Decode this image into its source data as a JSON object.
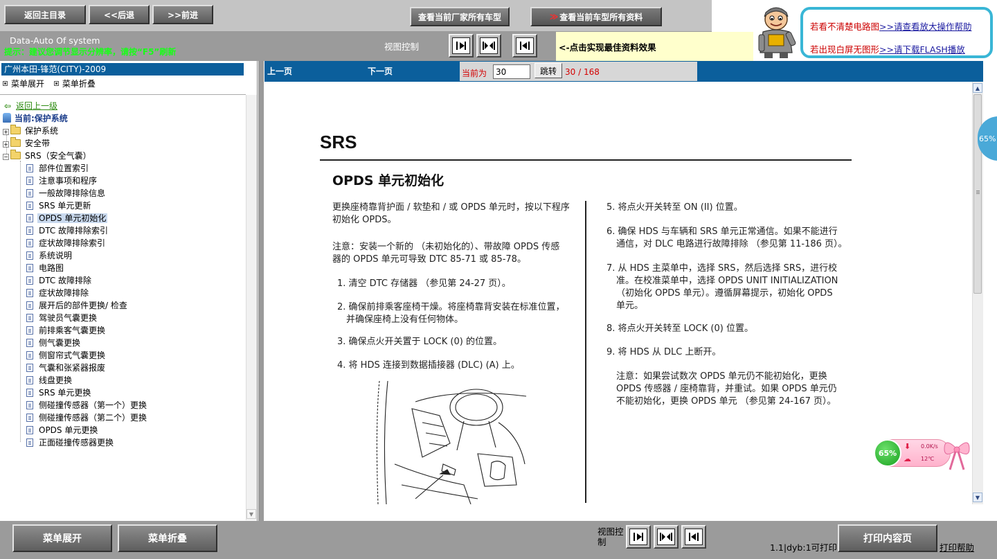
{
  "topbar": {
    "back_main": "返回主目录",
    "back": "<<后退",
    "forward": ">>前进",
    "view_maker_models": "查看当前厂家所有车型",
    "view_model_all": "查看当前车型所有资料"
  },
  "help": {
    "line1_text": "若看不清楚电路图",
    "line1_link": ">>请查看放大操作帮助",
    "line2_text": "若出现白屏无图形",
    "line2_link": ">>请下载FLASH播放"
  },
  "bar2": {
    "system_title": "Data-Auto Of system",
    "notice": "提示：建议您调节显示分辨率，请按“F5”刷新",
    "view_control": "视图控制",
    "tip": "<-点击实现最佳资料效果"
  },
  "left": {
    "vehicle": "广州本田-锋范(CITY)-2009",
    "expand": "菜单展开",
    "collapse": "菜单折叠",
    "back_up": "返回上一级",
    "current": "当前:保护系统",
    "folders": [
      "保护系统",
      "安全带",
      "SRS（安全气囊）"
    ],
    "items": [
      "部件位置索引",
      "注意事项和程序",
      "一般故障排除信息",
      "SRS 单元更新",
      "OPDS 单元初始化",
      "DTC 故障排除索引",
      "症状故障排除索引",
      "系统说明",
      "电路图",
      "DTC 故障排除",
      "症状故障排除",
      "展开后的部件更换/ 检查",
      "驾驶员气囊更换",
      "前排乘客气囊更换",
      "侧气囊更换",
      "侧窗帘式气囊更换",
      "气囊和张紧器报废",
      "线盘更换",
      "SRS 单元更换",
      "侧碰撞传感器（第一个）更换",
      "侧碰撞传感器（第二个）更换",
      "OPDS 单元更换",
      "正面碰撞传感器更换"
    ]
  },
  "nav": {
    "prev": "上一页",
    "next": "下一页",
    "current_label": "当前为",
    "page_value": "30",
    "go": "跳转",
    "count": "30 / 168"
  },
  "doc": {
    "h1": "SRS",
    "h2": "OPDS 单元初始化",
    "intro1": "更换座椅靠背护面 / 软垫和 / 或 OPDS 单元时，按以下程序",
    "intro2": "初始化 OPDS。",
    "note1": "注意：安装一个新的 （未初始化的）、带故障 OPDS 传感",
    "note2": "器的 OPDS 单元可导致 DTC 85-71 或 85-78。",
    "s1": "1. 清空 DTC 存储器 （参见第 24-27 页）。",
    "s2a": "2. 确保前排乘客座椅干燥。将座椅靠背安装在标准位置，",
    "s2b": "并确保座椅上没有任何物体。",
    "s3": "3. 确保点火开关置于 LOCK (0) 的位置。",
    "s4": "4. 将 HDS 连接到数据插接器 (DLC) (A) 上。",
    "s5": "5. 将点火开关转至 ON (II) 位置。",
    "s6a": "6. 确保 HDS 与车辆和 SRS 单元正常通信。如果不能进行",
    "s6b": "通信，对 DLC 电路进行故障排除 （参见第 11-186 页）。",
    "s7a": "7. 从 HDS 主菜单中，选择 SRS，然后选择 SRS，进行校",
    "s7b": "准。在校准菜单中，选择 OPDS UNIT INITIALIZATION",
    "s7c": "（初始化 OPDS 单元）。遵循屏幕提示，初始化 OPDS",
    "s7d": "单元。",
    "s8": "8. 将点火开关转至 LOCK (0) 位置。",
    "s9": "9. 将 HDS 从 DLC 上断开。",
    "n2a": "注意：如果尝试数次 OPDS 单元仍不能初始化，更换",
    "n2b": "OPDS 传感器 / 座椅靠背，并重试。如果 OPDS 单元仍",
    "n2c": "不能初始化，更换 OPDS 单元 （参见第 24-167 页）。"
  },
  "widget": {
    "edge_pct": "65%",
    "net_pct": "65%",
    "speed": "0.0K/s",
    "temp": "12℃"
  },
  "bottom": {
    "expand": "菜单展开",
    "collapse": "菜单折叠",
    "view_control": "视图控制",
    "status": "1.1|dyb:1可打印",
    "print": "打印内容页",
    "print_help": "打印帮助"
  },
  "colors": {
    "nav_blue": "#0b5f9c",
    "gray_bar": "#9b9b9b",
    "accent_green": "#18ff18",
    "help_border": "#39b6d6"
  }
}
